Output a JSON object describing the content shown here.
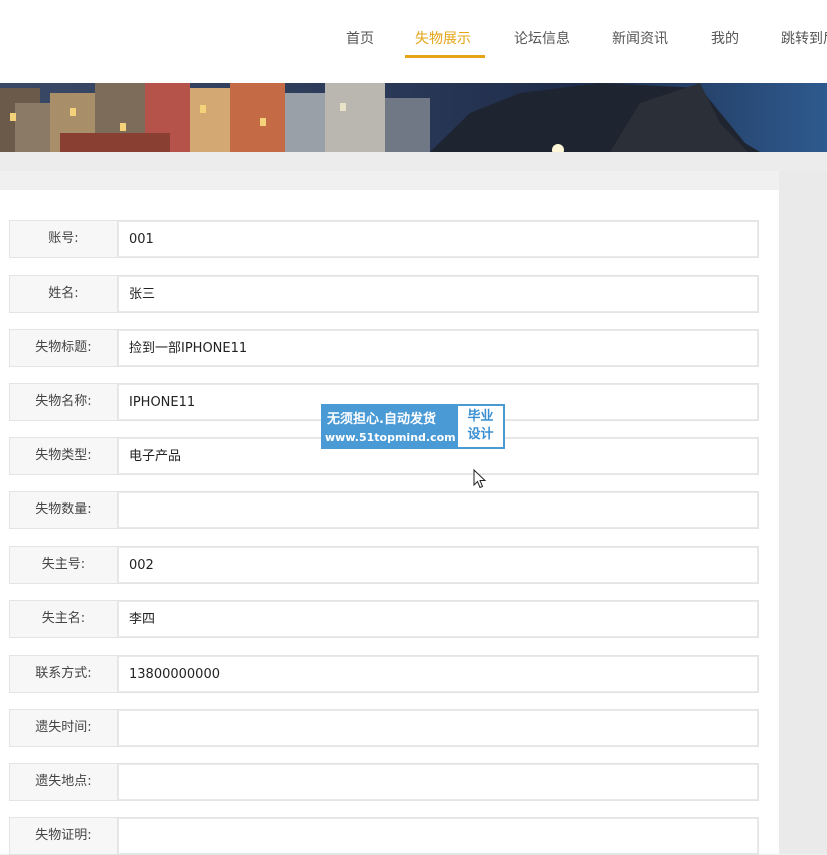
{
  "nav": {
    "items": [
      {
        "label": "首页",
        "active": false
      },
      {
        "label": "失物展示",
        "active": true
      },
      {
        "label": "论坛信息",
        "active": false
      },
      {
        "label": "新闻资讯",
        "active": false
      },
      {
        "label": "我的",
        "active": false
      },
      {
        "label": "跳转到后台",
        "active": false
      }
    ],
    "accent_color": "#e5a415"
  },
  "detail": {
    "rows": [
      {
        "label": "账号:",
        "value": "001"
      },
      {
        "label": "姓名:",
        "value": "张三"
      },
      {
        "label": "失物标题:",
        "value": "捡到一部IPHONE11"
      },
      {
        "label": "失物名称:",
        "value": "IPHONE11"
      },
      {
        "label": "失物类型:",
        "value": "电子产品"
      },
      {
        "label": "失物数量:",
        "value": ""
      },
      {
        "label": "失主号:",
        "value": "002"
      },
      {
        "label": "失主名:",
        "value": "李四"
      },
      {
        "label": "联系方式:",
        "value": "13800000000"
      },
      {
        "label": "遗失时间:",
        "value": ""
      },
      {
        "label": "遗失地点:",
        "value": ""
      },
      {
        "label": "失物证明:",
        "value": ""
      }
    ]
  },
  "watermark": {
    "line1": "无须担心.自动发货",
    "line2": "www.51topmind.com",
    "badge_top": "毕业",
    "badge_bottom": "设计"
  }
}
